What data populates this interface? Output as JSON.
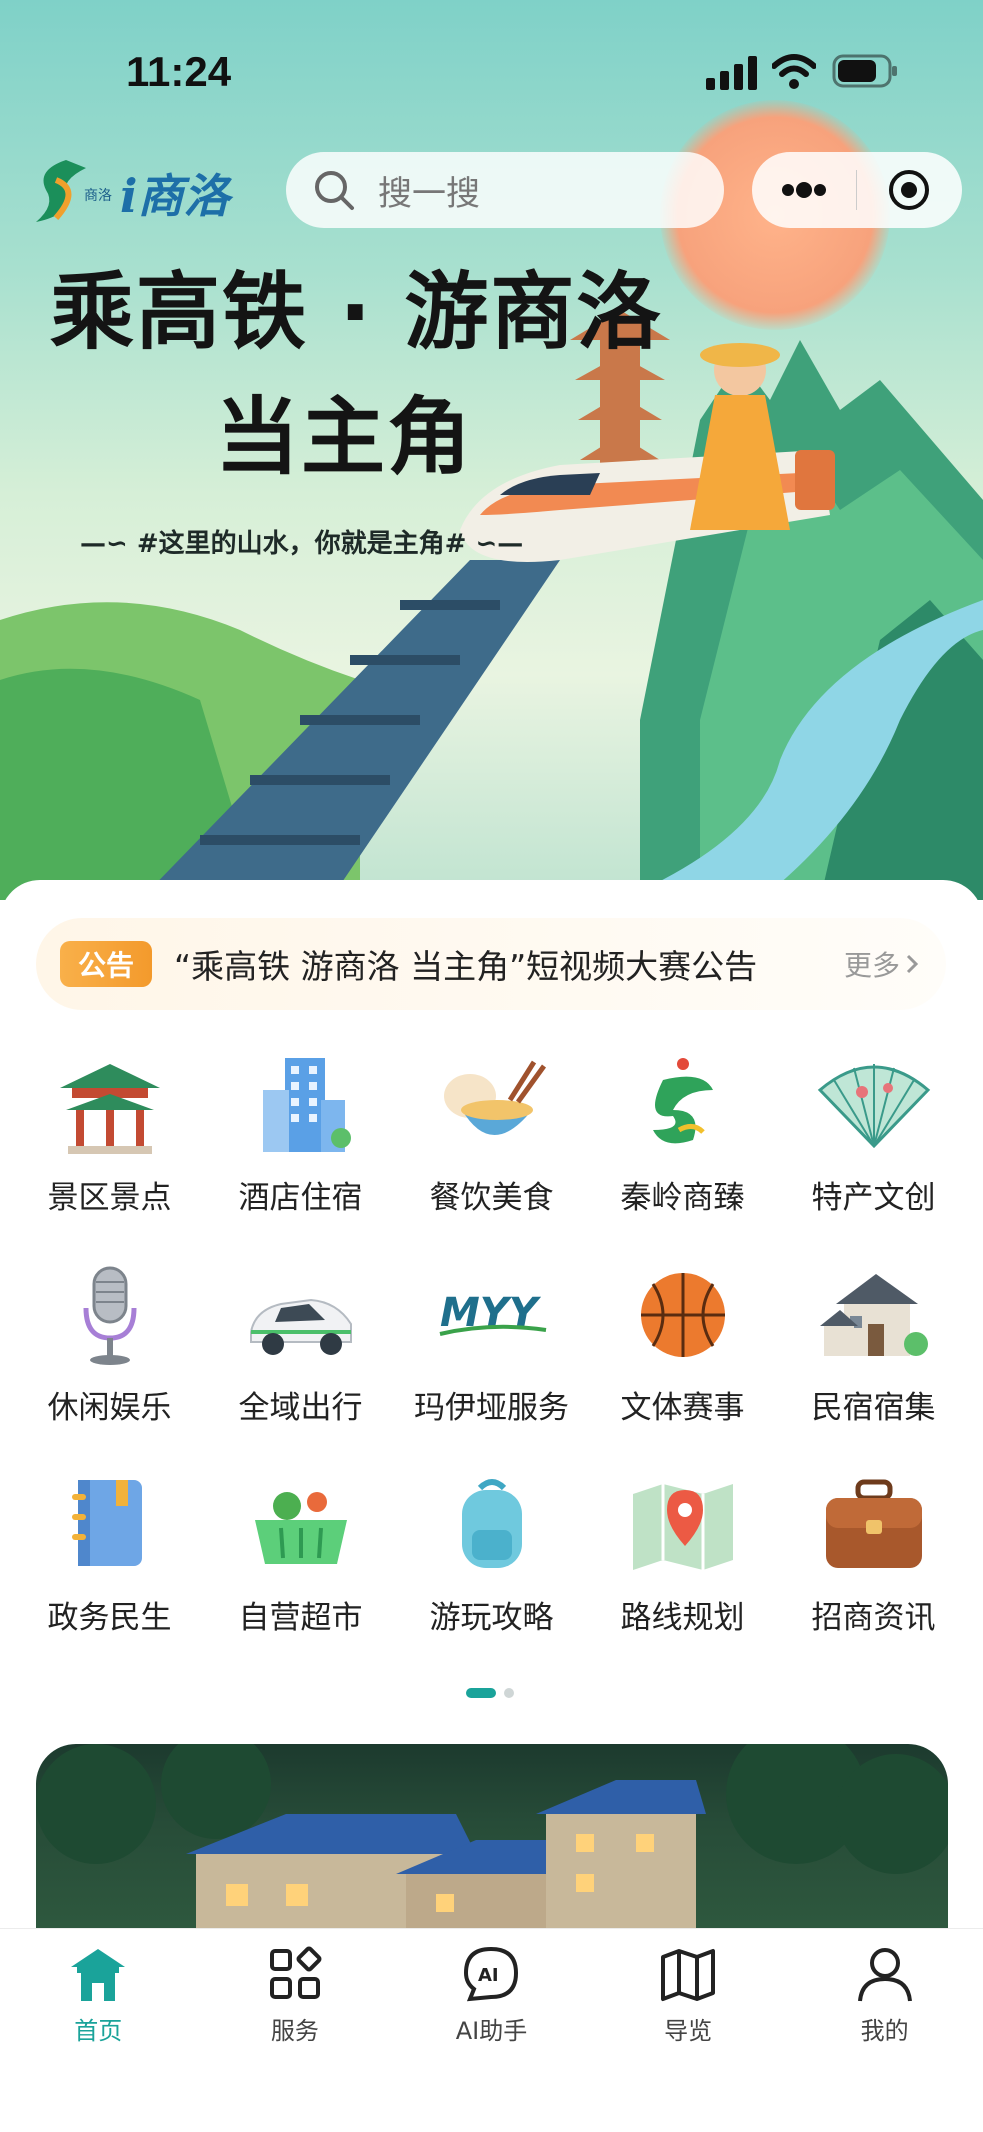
{
  "status_bar": {
    "time": "11:24"
  },
  "header": {
    "logo_text": "i商洛",
    "search_placeholder": "搜一搜"
  },
  "hero": {
    "headline_line1": "乘高铁 · 游商洛",
    "headline_line2": "当主角",
    "slogan": "#这里的山水，你就是主角#"
  },
  "notice": {
    "tag": "公告",
    "text": "“乘高铁 游商洛 当主角”短视频大赛公告",
    "more": "更多"
  },
  "services": [
    {
      "label": "景区景点",
      "icon": "pavilion-icon"
    },
    {
      "label": "酒店住宿",
      "icon": "hotel-building-icon"
    },
    {
      "label": "餐饮美食",
      "icon": "food-bowl-icon"
    },
    {
      "label": "秦岭商臻",
      "icon": "qinling-brand-icon"
    },
    {
      "label": "特产文创",
      "icon": "folding-fan-icon"
    },
    {
      "label": "休闲娱乐",
      "icon": "microphone-icon"
    },
    {
      "label": "全域出行",
      "icon": "car-icon"
    },
    {
      "label": "玛伊垭服务",
      "icon": "myy-logo-icon"
    },
    {
      "label": "文体赛事",
      "icon": "basketball-icon"
    },
    {
      "label": "民宿宿集",
      "icon": "house-icon"
    },
    {
      "label": "政务民生",
      "icon": "notebook-icon"
    },
    {
      "label": "自营超市",
      "icon": "shopping-basket-icon"
    },
    {
      "label": "游玩攻略",
      "icon": "backpack-icon"
    },
    {
      "label": "路线规划",
      "icon": "map-pin-icon"
    },
    {
      "label": "招商资讯",
      "icon": "briefcase-icon"
    }
  ],
  "pager": {
    "current": 1,
    "total": 2
  },
  "tabbar": {
    "items": [
      {
        "label": "首页",
        "icon": "home-icon",
        "active": true
      },
      {
        "label": "服务",
        "icon": "grid-icon",
        "active": false
      },
      {
        "label": "AI助手",
        "icon": "ai-chat-icon",
        "active": false
      },
      {
        "label": "导览",
        "icon": "map-icon",
        "active": false
      },
      {
        "label": "我的",
        "icon": "user-icon",
        "active": false
      }
    ]
  },
  "colors": {
    "accent": "#1aa39a",
    "notice_tag": "#f39a2c"
  }
}
